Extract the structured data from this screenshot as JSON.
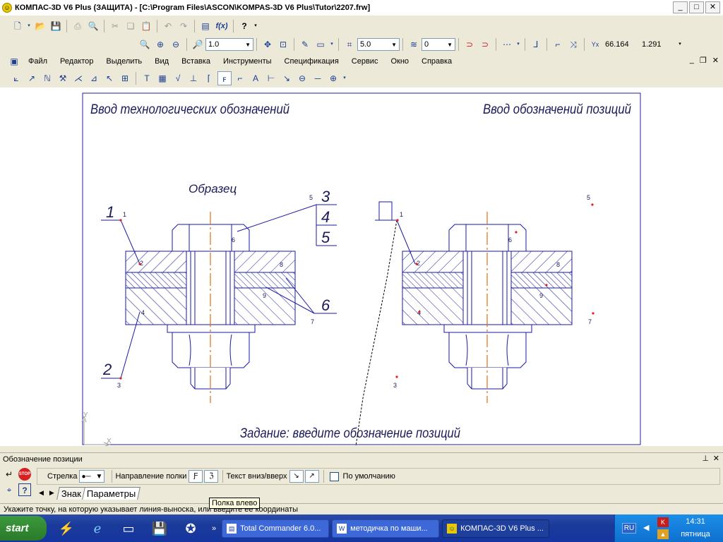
{
  "window": {
    "title": "КОМПАС-3D V6 Plus (ЗАЩИТА) - [C:\\Program Files\\ASCON\\KOMPAS-3D V6 Plus\\Tutor\\2207.frw]",
    "btn_min": "_",
    "btn_max": "□",
    "btn_close": "✕"
  },
  "toolbar1": {
    "fx_label": "f(x)",
    "help_label": "?"
  },
  "toolbar2": {
    "zoom_value": "1.0",
    "step_value": "5.0",
    "layer_value": "0",
    "coord_x": "66.164",
    "coord_y": "1.291"
  },
  "menu": {
    "items": [
      "Файл",
      "Редактор",
      "Выделить",
      "Вид",
      "Вставка",
      "Инструменты",
      "Спецификация",
      "Сервис",
      "Окно",
      "Справка"
    ],
    "mdi_min": "_",
    "mdi_restore": "❐",
    "mdi_close": "✕"
  },
  "drawing": {
    "heading_left": "Ввод технологических обозначений",
    "heading_right": "Ввод обозначений позиций",
    "sample_label": "Образец",
    "task_text": "Задание: введите обозначение позиций",
    "leader_labels": [
      "1",
      "2",
      "3",
      "4",
      "5",
      "6"
    ],
    "point_numbers": [
      "1",
      "2",
      "3",
      "4",
      "5",
      "6",
      "7",
      "8",
      "9"
    ],
    "axis_x": "X",
    "axis_y": "Y"
  },
  "panel": {
    "header": "Обозначение позиции",
    "pin": "⊥",
    "close": "✕",
    "arrow_label": "Стрелка",
    "shelf_direction_label": "Направление полки",
    "text_direction_label": "Текст вниз/вверх",
    "default_label": "По умолчанию",
    "default_checked": false,
    "tabs": [
      "Знак",
      "Параметры"
    ],
    "active_tab": "Параметры"
  },
  "tooltip": "Полка влево",
  "status": "Укажите точку, на которую указывает линия-выноска, или введите ее координаты",
  "taskbar": {
    "start_label": "start",
    "tasks": [
      {
        "label": "Total Commander 6.0...",
        "active": false
      },
      {
        "label": "методичка по маши...",
        "active": false
      },
      {
        "label": "КОМПАС-3D V6 Plus ...",
        "active": true
      }
    ],
    "lang": "RU",
    "time": "14:31",
    "day": "пятница"
  },
  "colors": {
    "drawing_line": "#1a1aa8",
    "axis_line": "#e07010",
    "point_marker": "#e02020",
    "frame": "#2020a0"
  }
}
